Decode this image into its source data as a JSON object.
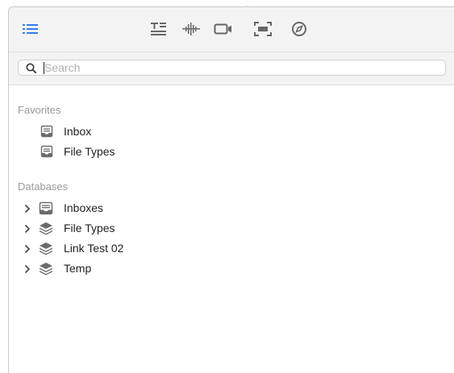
{
  "toolbar": {
    "list_icon": "list-icon",
    "tools": [
      "text-format-icon",
      "audio-waveform-icon",
      "video-camera-icon",
      "screen-capture-icon",
      "safari-compass-icon"
    ],
    "accent_color": "#2f7cf6"
  },
  "search": {
    "placeholder": "Search",
    "value": ""
  },
  "favorites": {
    "header": "Favorites",
    "items": [
      {
        "label": "Inbox",
        "icon": "inbox-tray-icon"
      },
      {
        "label": "File Types",
        "icon": "inbox-tray-icon"
      }
    ]
  },
  "databases": {
    "header": "Databases",
    "items": [
      {
        "label": "Inboxes",
        "icon": "inbox-tray-icon"
      },
      {
        "label": "File Types",
        "icon": "database-stack-icon"
      },
      {
        "label": "Link Test 02",
        "icon": "database-stack-icon"
      },
      {
        "label": "Temp",
        "icon": "database-stack-icon"
      }
    ]
  }
}
